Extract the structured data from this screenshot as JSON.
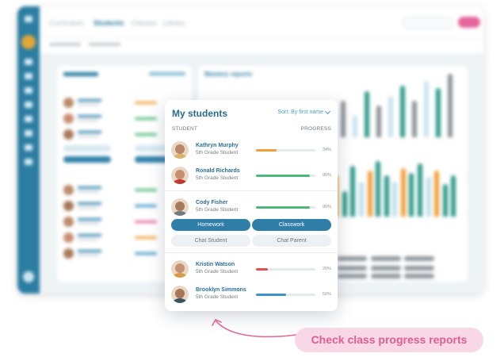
{
  "background_app": {
    "nav": [
      "Curriculum",
      "Students",
      "Classes",
      "Library"
    ],
    "active_nav": "Students",
    "mastery_title": "Mastery reports",
    "chart_bars": [
      14,
      22,
      30,
      18,
      38,
      26,
      34,
      42,
      30,
      46,
      40,
      52
    ],
    "lower_bars": [
      20,
      28,
      36,
      22,
      44,
      30,
      40,
      48,
      36,
      30,
      42,
      38,
      46,
      34,
      40,
      28,
      36
    ]
  },
  "card": {
    "title": "My students",
    "sort_label": "Sort: By first name",
    "col_student": "STUDENT",
    "col_progress": "PROGRESS",
    "students": [
      {
        "name": "Kathryn Murphy",
        "grade": "5th Grade Student",
        "progress": 0.34,
        "pct": "34%",
        "color": "#f0a03a",
        "skin": "#b8866a",
        "shirt": "#d9b46a"
      },
      {
        "name": "Ronald Richards",
        "grade": "5th Grade Student",
        "progress": 0.9,
        "pct": "90%",
        "color": "#4cb87a",
        "skin": "#c98e72",
        "shirt": "#c0392b"
      },
      {
        "name": "Cody Fisher",
        "grade": "5th Grade Student",
        "progress": 0.9,
        "pct": "90%",
        "color": "#4cb87a",
        "skin": "#a87a5c",
        "shirt": "#6f7c80"
      },
      {
        "name": "Kristin Watson",
        "grade": "5th Grade Student",
        "progress": 0.2,
        "pct": "20%",
        "color": "#e0514f",
        "skin": "#c59276",
        "shirt": "#d89a4a"
      },
      {
        "name": "Brooklyn Simmons",
        "grade": "5th Grade Student",
        "progress": 0.5,
        "pct": "50%",
        "color": "#3e94c6",
        "skin": "#a57658",
        "shirt": "#3b5166"
      }
    ],
    "buttons": {
      "homework": "Homework",
      "classwork": "Classwork",
      "chat_student": "Chat Student",
      "chat_parent": "Chat Parent"
    }
  },
  "callout": "Check class progress reports"
}
